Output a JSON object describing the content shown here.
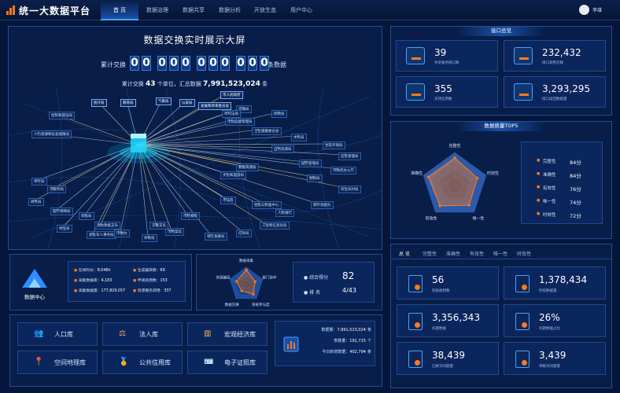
{
  "app_title": "统一大数据平台",
  "nav": [
    "首 页",
    "数据治理",
    "数据共享",
    "数据分析",
    "开放生态",
    "用户中心"
  ],
  "user": {
    "name": "李雄"
  },
  "screen": {
    "title": "数据交换实时展示大屏",
    "counter_label": "累计交换",
    "counter_digits": [
      "0",
      "0",
      "0",
      "0",
      "0",
      "0",
      "0",
      "0",
      "0",
      "0",
      "0"
    ],
    "counter_unit": "条数据",
    "summary_prefix": "累计交换",
    "summary_units": "43",
    "summary_mid": "个单位，汇总数据",
    "summary_total": "7,991,523,024",
    "summary_suffix": "条"
  },
  "map_labels": [
    "统计局",
    "教育局",
    "气象局",
    "市人民政府",
    "发展和改革委员会",
    "公安局",
    "交通局",
    "民政局",
    "市司法局",
    "住房和建设局",
    "人力资源和社会保障局",
    "市场监督管理局",
    "卫生健康委员会",
    "水务局",
    "生态环境局",
    "自然资源局",
    "应急管理局",
    "城市管理局",
    "数据资源局",
    "市政府办公厅",
    "文化和旅游局",
    "财政局",
    "审计局",
    "市税务局",
    "商务局",
    "医疗保障局",
    "林业局",
    "退役军人事务局",
    "市委办",
    "体育局",
    "市档案馆",
    "地方金融局",
    "信访局",
    "工业和信息化局",
    "人民银行",
    "统计调查队",
    "住房公积金中心",
    "市法院",
    "市检察院",
    "交警支队",
    "消防救援支队",
    "科技局",
    "农业农村局"
  ],
  "center": {
    "name": "数据中心",
    "stats": [
      {
        "label": "在线时长",
        "value": "8,048h"
      },
      {
        "label": "生成编目数",
        "value": "69"
      },
      {
        "label": "采集数据库",
        "value": "4,183"
      },
      {
        "label": "申请资源数",
        "value": "153"
      },
      {
        "label": "采集数据量",
        "value": "177,829,057"
      },
      {
        "label": "资源服务调用",
        "value": "337"
      }
    ]
  },
  "mini_radar": {
    "labels": [
      "数据采集",
      "部门协作",
      "系统参与度",
      "数据交换",
      "资源编目"
    ],
    "values": [
      0.85,
      0.55,
      0.7,
      0.45,
      0.6
    ]
  },
  "score": {
    "label": "综合得分",
    "value": "82",
    "rank_label": "排 名",
    "rank_value": "4/43"
  },
  "libraries": [
    {
      "name": "人口库",
      "icon": "population-icon"
    },
    {
      "name": "法人库",
      "icon": "legal-person-icon"
    },
    {
      "name": "宏观经济库",
      "icon": "economy-icon"
    },
    {
      "name": "空间地理库",
      "icon": "geo-icon"
    },
    {
      "name": "公共信用库",
      "icon": "credit-icon"
    },
    {
      "name": "电子证照库",
      "icon": "license-icon"
    }
  ],
  "data_summary": [
    {
      "label": "数据量",
      "value": "7,991,523,024",
      "unit": "条"
    },
    {
      "label": "表数量",
      "value": "191,715",
      "unit": "个"
    },
    {
      "label": "今日新增数据",
      "value": "402,794",
      "unit": "条"
    }
  ],
  "api_overview": {
    "title": "接口总览",
    "items": [
      {
        "value": "39",
        "label": "共享服务接口数"
      },
      {
        "value": "232,432",
        "label": "接口调用次数"
      },
      {
        "value": "355",
        "label": "支持应用数"
      },
      {
        "value": "3,293,295",
        "label": "接口返回数据量"
      }
    ]
  },
  "quality": {
    "title": "数据质量TOP5",
    "radar_labels": [
      "完整性",
      "时效性",
      "唯一性",
      "有效性",
      "准确性"
    ],
    "radar_values": [
      0.84,
      0.72,
      0.74,
      0.76,
      0.84
    ],
    "scores": [
      {
        "name": "完整性",
        "score": "84分"
      },
      {
        "name": "准确性",
        "score": "84分"
      },
      {
        "name": "有效性",
        "score": "76分"
      },
      {
        "name": "唯一性",
        "score": "74分"
      },
      {
        "name": "时效性",
        "score": "72分"
      }
    ],
    "tabs": [
      "总 览",
      "完整性",
      "准确性",
      "有效性",
      "唯一性",
      "时效性"
    ],
    "stats": [
      {
        "value": "56",
        "label": "检核规则数"
      },
      {
        "value": "1,378,434",
        "label": "检核数据量"
      },
      {
        "value": "3,356,343",
        "label": "问题数据"
      },
      {
        "value": "26%",
        "label": "问题数据占比"
      },
      {
        "value": "38,439",
        "label": "已解决问题量"
      },
      {
        "value": "3,439",
        "label": "待解决问题量"
      }
    ]
  },
  "colors": {
    "accent": "#3ea6ff",
    "orange": "#ff7a1a",
    "bg": "#06163a"
  }
}
